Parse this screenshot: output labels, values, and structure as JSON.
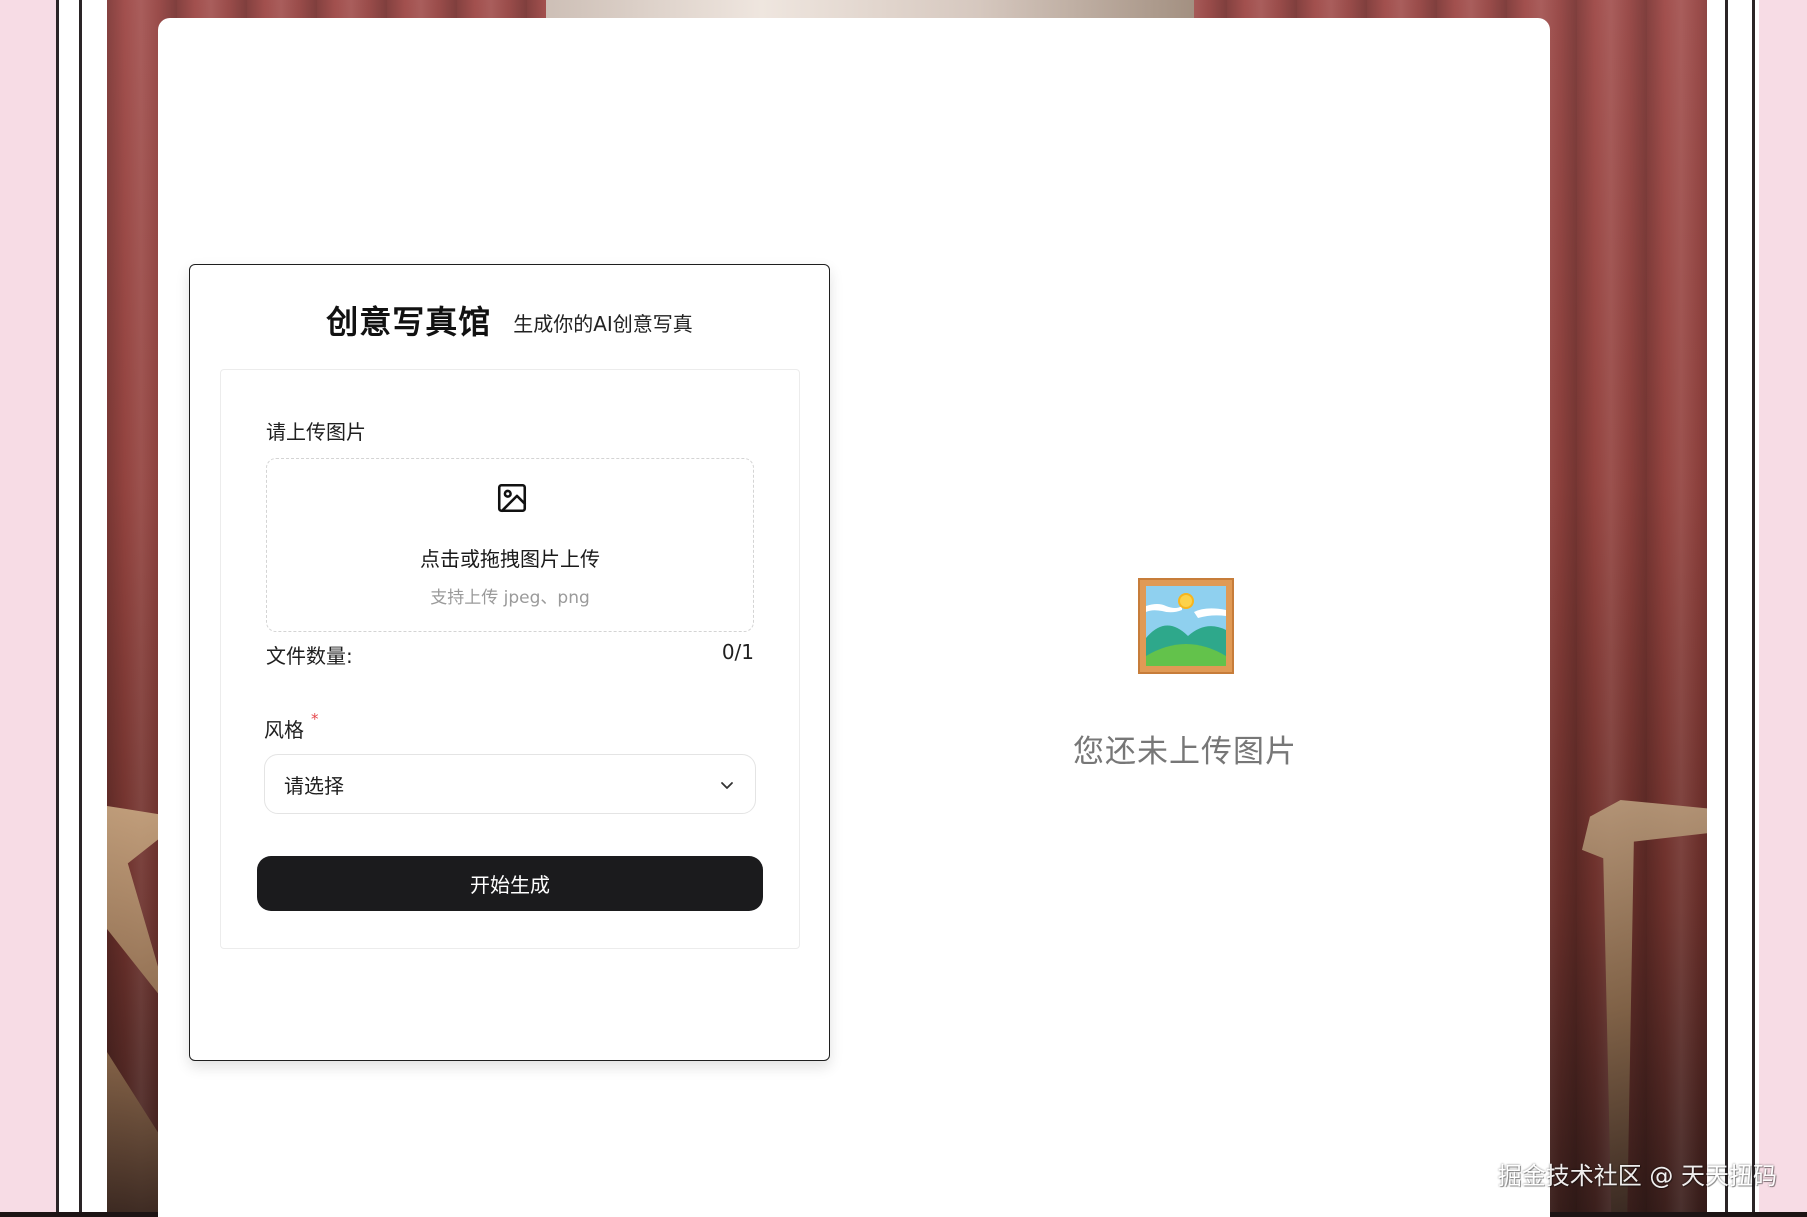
{
  "brand": {
    "title": "创意写真馆",
    "subtitle": "生成你的AI创意写真"
  },
  "upload": {
    "label": "请上传图片",
    "icon": "image-icon",
    "prompt": "点击或拖拽图片上传",
    "hint": "支持上传 jpeg、png",
    "count_label": "文件数量:",
    "count_value": "0/1"
  },
  "style": {
    "label": "风格",
    "required_mark": "*",
    "placeholder": "请选择",
    "chevron_icon": "chevron-down-icon"
  },
  "actions": {
    "generate_label": "开始生成"
  },
  "empty_state": {
    "icon": "framed-picture-icon",
    "text": "您还未上传图片"
  },
  "watermark": "掘金技术社区 @ 天天扭码",
  "colors": {
    "button_bg": "#1b1b1d",
    "required": "#e5484d",
    "curtain": "#93433f",
    "side_pink": "#f7dce5"
  }
}
